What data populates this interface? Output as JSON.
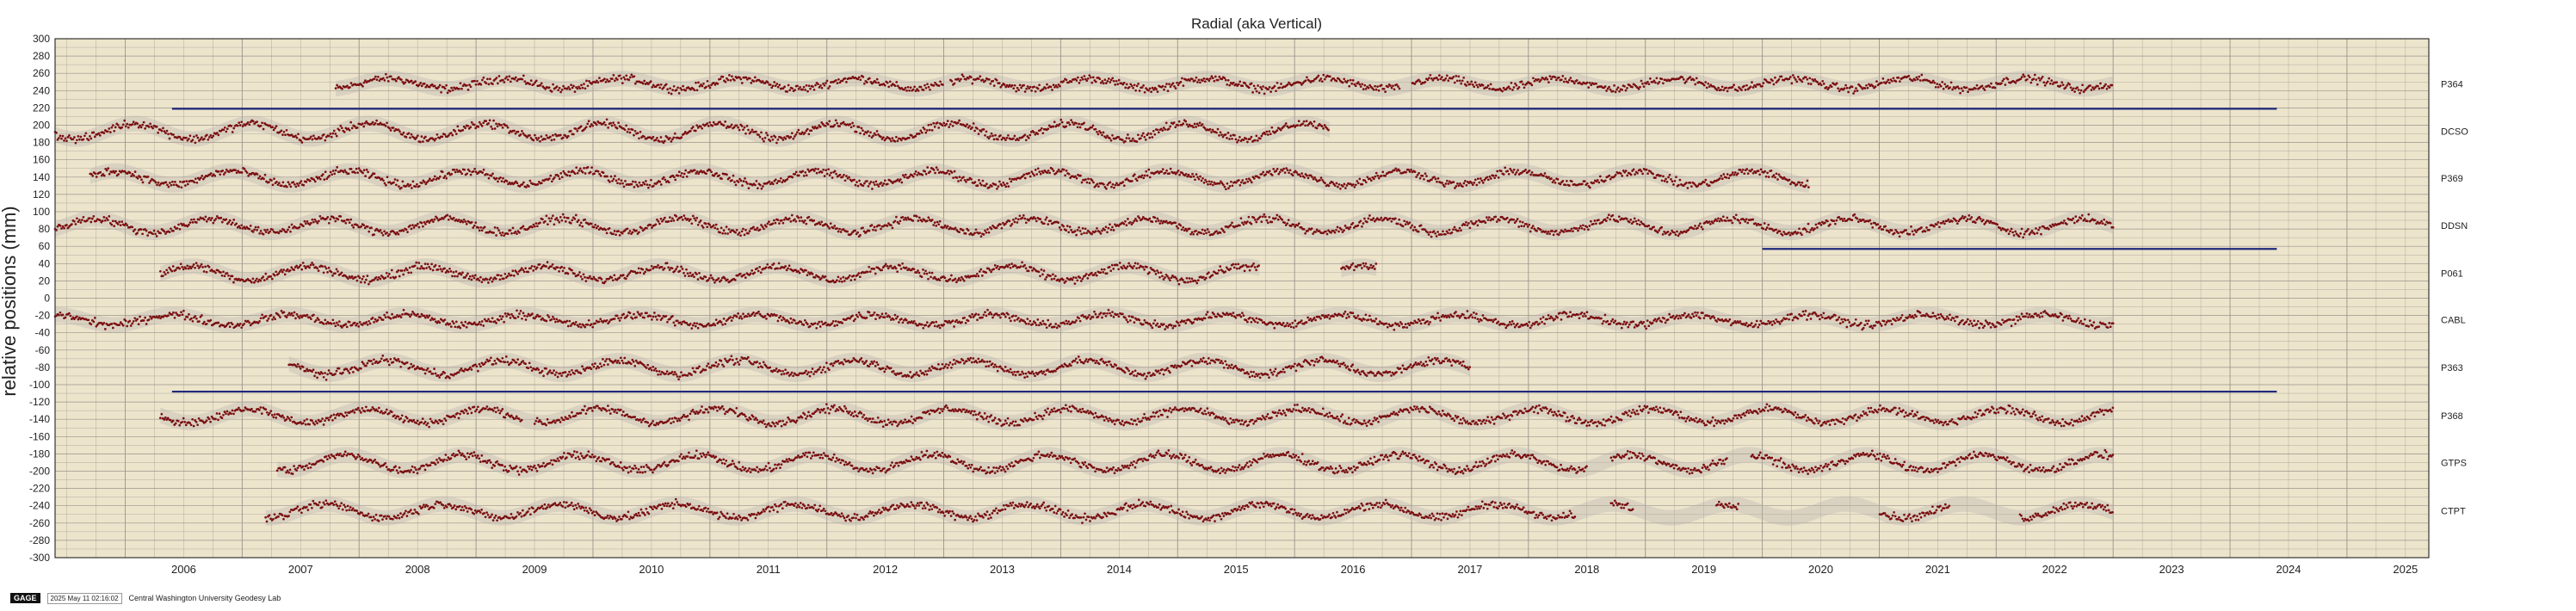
{
  "chart_data": {
    "type": "scatter",
    "title": "Radial (aka Vertical)",
    "xlabel": "",
    "ylabel": "relative positions (mm)",
    "xlim": [
      2005.4,
      2025.7
    ],
    "ylim": [
      -300,
      300
    ],
    "x_ticks": [
      "2006",
      "2007",
      "2008",
      "2009",
      "2010",
      "2011",
      "2012",
      "2013",
      "2014",
      "2015",
      "2016",
      "2017",
      "2018",
      "2019",
      "2020",
      "2021",
      "2022",
      "2023",
      "2024",
      "2025"
    ],
    "y_ticks": [
      -300,
      -280,
      -260,
      -240,
      -220,
      -200,
      -180,
      -160,
      -140,
      -120,
      -100,
      -80,
      -60,
      -40,
      -20,
      0,
      20,
      40,
      60,
      80,
      100,
      120,
      140,
      160,
      180,
      200,
      220,
      240,
      260,
      280,
      300
    ],
    "grid": true,
    "series": [
      {
        "name": "P364",
        "offset": 248,
        "start": 2007.8,
        "end": 2023.0,
        "amplitude": 6,
        "gaps": [
          [
            2013.0,
            2013.05
          ],
          [
            2016.9,
            2017.0
          ]
        ]
      },
      {
        "name": "DCSO",
        "offset": 193,
        "start": 2005.4,
        "end": 2016.3,
        "amplitude": 9,
        "gaps": []
      },
      {
        "name": "P369",
        "offset": 139,
        "start": 2005.7,
        "end": 2020.4,
        "amplitude": 8,
        "gaps": []
      },
      {
        "name": "DDSN",
        "offset": 84,
        "start": 2005.4,
        "end": 2023.0,
        "amplitude": 8,
        "gaps": []
      },
      {
        "name": "P061",
        "offset": 29,
        "start": 2006.3,
        "end": 2015.7,
        "amplitude": 8,
        "gaps": [],
        "extra": [
          2016.4,
          2016.7
        ]
      },
      {
        "name": "CABL",
        "offset": -25,
        "start": 2005.4,
        "end": 2023.0,
        "amplitude": 6,
        "gaps": []
      },
      {
        "name": "P363",
        "offset": -80,
        "start": 2007.4,
        "end": 2017.5,
        "amplitude": 8,
        "gaps": []
      },
      {
        "name": "P368",
        "offset": -136,
        "start": 2006.3,
        "end": 2023.0,
        "amplitude": 8,
        "gaps": [
          [
            2009.4,
            2009.5
          ]
        ]
      },
      {
        "name": "GTPS",
        "offset": -190,
        "start": 2007.3,
        "end": 2023.0,
        "amplitude": 9,
        "gaps": [
          [
            2018.5,
            2018.7
          ],
          [
            2019.7,
            2019.9
          ]
        ]
      },
      {
        "name": "CTPT",
        "offset": -246,
        "start": 2007.2,
        "end": 2023.0,
        "amplitude": 8,
        "gaps": [
          [
            2018.4,
            2018.7
          ],
          [
            2018.9,
            2019.6
          ],
          [
            2019.8,
            2021.0
          ],
          [
            2021.6,
            2022.2
          ]
        ]
      }
    ],
    "reference_lines": [
      {
        "y": 219,
        "x_start": 2006.4,
        "x_end": 2024.4
      },
      {
        "y": 57,
        "x_start": 2020.0,
        "x_end": 2024.4
      },
      {
        "y": -108,
        "x_start": 2006.4,
        "x_end": 2024.4
      }
    ],
    "colors": {
      "points": "#7a0f12",
      "background": "#ede4cc",
      "grid": "#9a958a",
      "reference_line": "#1f2a7a",
      "error_band": "#b8b3ad"
    }
  },
  "footer": {
    "badge": "GAGE",
    "timestamp": "2025 May 11 02:16:02",
    "credit": "Central Washington University Geodesy Lab"
  }
}
